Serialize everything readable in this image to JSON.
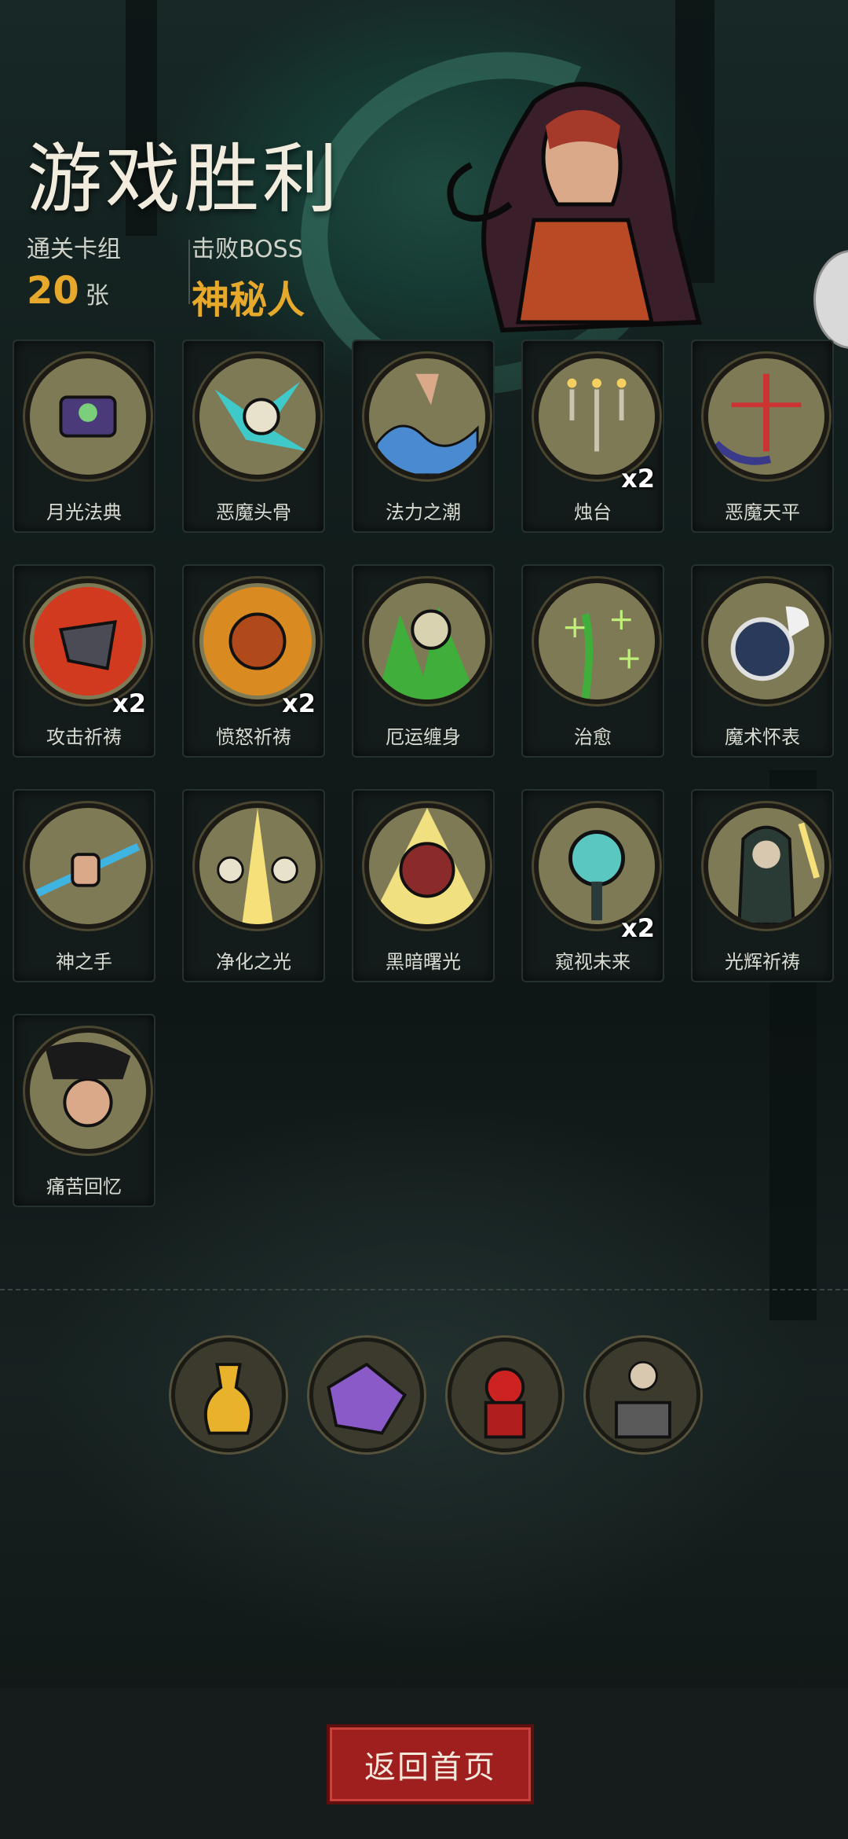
{
  "header": {
    "title": "游戏胜利",
    "deck_label": "通关卡组",
    "deck_count": "20",
    "deck_unit": "张",
    "boss_label": "击败BOSS",
    "boss_name": "神秘人"
  },
  "cards": [
    {
      "name": "月光法典",
      "count": "",
      "icon": "moonlight-tome-icon"
    },
    {
      "name": "恶魔头骨",
      "count": "",
      "icon": "demon-skull-icon"
    },
    {
      "name": "法力之潮",
      "count": "",
      "icon": "mana-tide-icon"
    },
    {
      "name": "烛台",
      "count": "x2",
      "icon": "candelabra-icon"
    },
    {
      "name": "恶魔天平",
      "count": "",
      "icon": "demon-scale-icon"
    },
    {
      "name": "攻击祈祷",
      "count": "x2",
      "icon": "attack-prayer-icon"
    },
    {
      "name": "愤怒祈祷",
      "count": "x2",
      "icon": "rage-prayer-icon"
    },
    {
      "name": "厄运缠身",
      "count": "",
      "icon": "doom-icon"
    },
    {
      "name": "治愈",
      "count": "",
      "icon": "heal-icon"
    },
    {
      "name": "魔术怀表",
      "count": "",
      "icon": "magic-pocket-watch-icon"
    },
    {
      "name": "神之手",
      "count": "",
      "icon": "hand-of-god-icon"
    },
    {
      "name": "净化之光",
      "count": "",
      "icon": "purifying-light-icon"
    },
    {
      "name": "黑暗曙光",
      "count": "",
      "icon": "dark-dawn-icon"
    },
    {
      "name": "窥视未来",
      "count": "x2",
      "icon": "foresight-icon"
    },
    {
      "name": "光辉祈祷",
      "count": "",
      "icon": "radiant-prayer-icon"
    },
    {
      "name": "痛苦回忆",
      "count": "",
      "icon": "painful-memory-icon"
    }
  ],
  "relics": [
    {
      "icon": "golden-vase-relic-icon"
    },
    {
      "icon": "purple-beast-relic-icon"
    },
    {
      "icon": "red-demon-relic-icon"
    },
    {
      "icon": "priest-altar-relic-icon"
    }
  ],
  "footer": {
    "home_label": "返回首页"
  },
  "colors": {
    "accent_gold": "#e7a92b",
    "button_red": "#9e1f1d",
    "medal_base": "#7e7a56"
  }
}
